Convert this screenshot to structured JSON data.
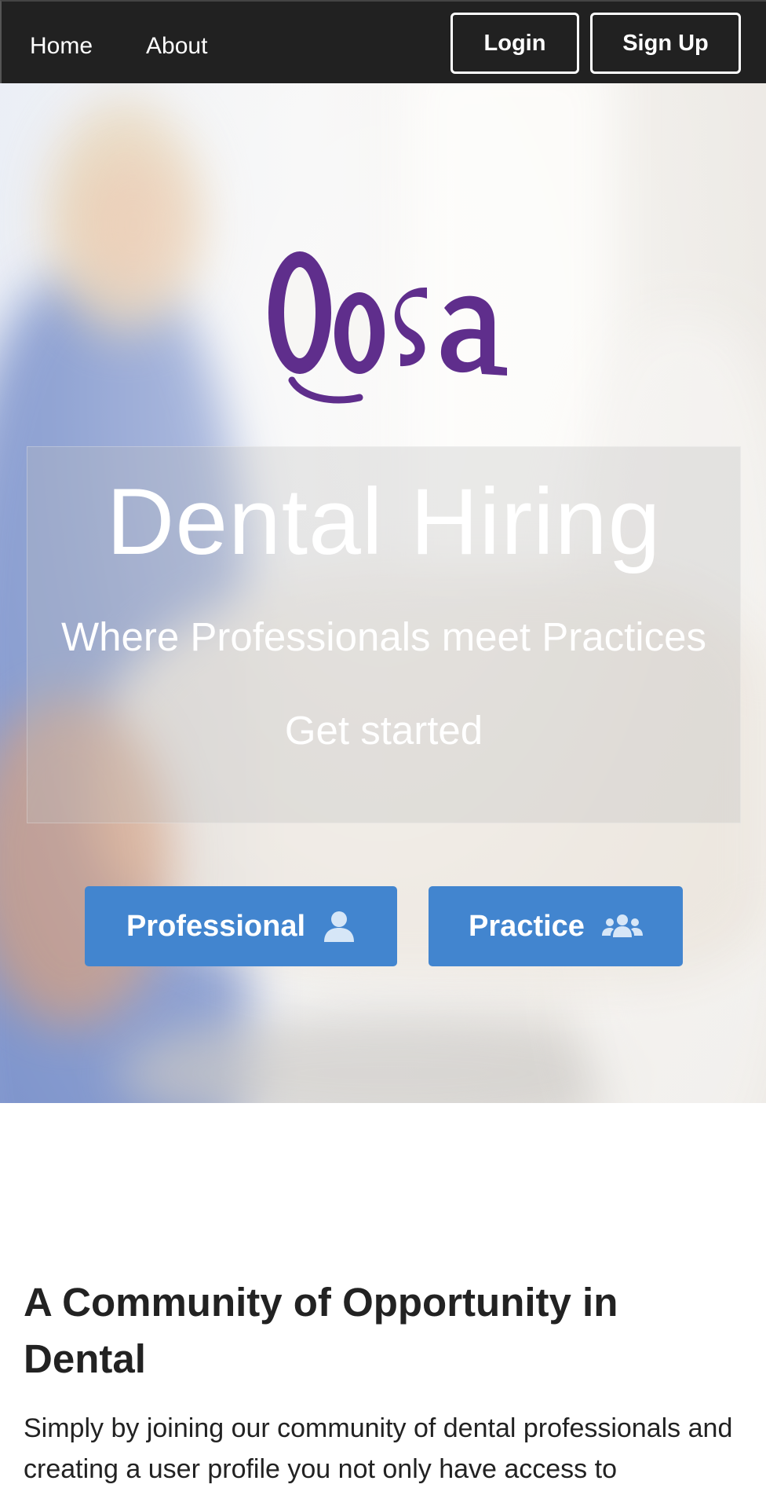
{
  "nav": {
    "home_label": "Home",
    "about_label": "About",
    "login_label": "Login",
    "signup_label": "Sign Up"
  },
  "hero": {
    "logo_text": "Qosa",
    "title": "Dental Hiring",
    "subtitle": "Where Professionals meet Practices",
    "cta": "Get started",
    "professional_label": "Professional",
    "practice_label": "Practice",
    "professional_icon": "user-icon",
    "practice_icon": "users-icon"
  },
  "community": {
    "title": "A Community of Opportunity in Dental",
    "body": "Simply by joining our community of dental professionals and creating a user profile you not only have access to"
  },
  "colors": {
    "navbar": "#212121",
    "button_blue": "#4285cf",
    "logo_purple": "#5f2e8c",
    "text_dark": "#222222"
  }
}
